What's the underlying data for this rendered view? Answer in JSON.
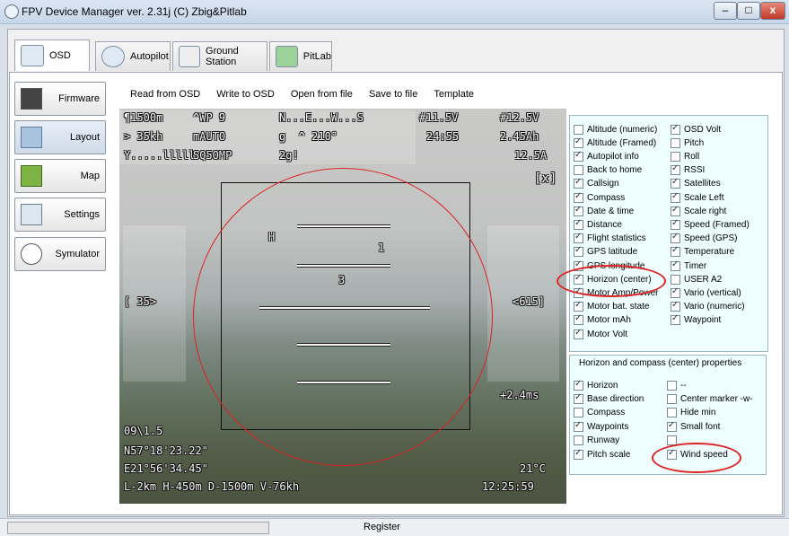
{
  "window": {
    "title": "FPV Device Manager ver. 2.31j  (C) Zbig&Pitlab",
    "min_label": "–",
    "max_label": "□",
    "close_label": "x"
  },
  "tabs": [
    "OSD",
    "Autopilot",
    "Ground Station",
    "PitLab"
  ],
  "side_buttons": [
    "Firmware",
    "Layout",
    "Map",
    "Settings",
    "Symulator"
  ],
  "toolbar": [
    "Read from OSD",
    "Write to OSD",
    "Open from file",
    "Save to file",
    "Template"
  ],
  "osd": {
    "alt": "¶1500m",
    "wp": "^WP 9",
    "compass_tape": "N...E...W...S",
    "bat1": "#11.5V",
    "bat2": "#12.5V",
    "speed": "> 35kh",
    "mode": "mAUTO",
    "heading": "g  ^ 210°",
    "time": "24:55",
    "mah": "2.45Ah",
    "rssi": "Y.....lllll",
    "callsign": "SQ5OMP",
    "gforce": "2g!",
    "current": "12.5A",
    "x_mark": "[x]",
    "h_mark": "H",
    "pitch1": "1",
    "pitch3": "3",
    "left_speed": "[ 35>",
    "right_alt": "<615]",
    "wind": "+2.4ms",
    "sats": "09\\1.5",
    "lat": "N57°18'23.22\"",
    "lon": "E21°56'34.45\"",
    "temp": "21°C",
    "bottom_line": "L-2km H-450m D-1500m V-76kh",
    "clock": "12:25:59"
  },
  "options_left": [
    {
      "label": "Altitude (numeric)",
      "checked": false
    },
    {
      "label": "Altitude (Framed)",
      "checked": true
    },
    {
      "label": "Autopilot info",
      "checked": true
    },
    {
      "label": "Back to home",
      "checked": false
    },
    {
      "label": "Callsign",
      "checked": true
    },
    {
      "label": "Compass",
      "checked": true
    },
    {
      "label": "Date & time",
      "checked": true
    },
    {
      "label": "Distance",
      "checked": true
    },
    {
      "label": "Flight statistics",
      "checked": true
    },
    {
      "label": "GPS latitude",
      "checked": true
    },
    {
      "label": "GPS longitude",
      "checked": true
    },
    {
      "label": "Horizon (center)",
      "checked": true
    },
    {
      "label": "Motor Amp/Power",
      "checked": true
    },
    {
      "label": "Motor bat. state",
      "checked": true
    },
    {
      "label": "Motor mAh",
      "checked": true
    },
    {
      "label": "Motor Volt",
      "checked": true
    }
  ],
  "options_right": [
    {
      "label": "OSD Volt",
      "checked": true
    },
    {
      "label": "Pitch",
      "checked": false
    },
    {
      "label": "Roll",
      "checked": false
    },
    {
      "label": "RSSI",
      "checked": true
    },
    {
      "label": "Satellites",
      "checked": true
    },
    {
      "label": "Scale Left",
      "checked": true
    },
    {
      "label": "Scale right",
      "checked": true
    },
    {
      "label": "Speed (Framed)",
      "checked": true
    },
    {
      "label": "Speed (GPS)",
      "checked": true
    },
    {
      "label": "Temperature",
      "checked": true
    },
    {
      "label": "Timer",
      "checked": true
    },
    {
      "label": "USER A2",
      "checked": false
    },
    {
      "label": "Vario (vertical)",
      "checked": true
    },
    {
      "label": "Vario (numeric)",
      "checked": true
    },
    {
      "label": "Waypoint",
      "checked": true
    }
  ],
  "props": {
    "title": "Horizon and compass (center)  properties",
    "left": [
      {
        "label": "Horizon",
        "checked": true
      },
      {
        "label": "Base direction",
        "checked": true
      },
      {
        "label": "Compass",
        "checked": false
      },
      {
        "label": "Waypoints",
        "checked": true
      },
      {
        "label": "Runway",
        "checked": false
      },
      {
        "label": "Pitch scale",
        "checked": true
      }
    ],
    "right": [
      {
        "label": "--",
        "checked": false
      },
      {
        "label": "Center marker  -w-",
        "checked": false
      },
      {
        "label": "Hide min",
        "checked": false
      },
      {
        "label": "Small font",
        "checked": true
      },
      {
        "label": "",
        "checked": false
      },
      {
        "label": "Wind speed",
        "checked": true
      }
    ]
  },
  "status": {
    "register": "Register"
  }
}
